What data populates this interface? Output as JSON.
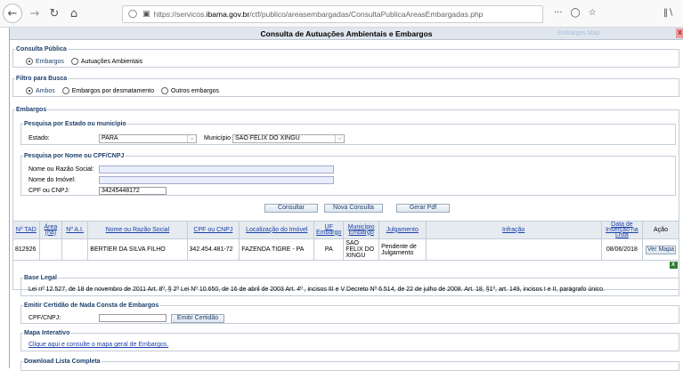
{
  "browser": {
    "url_prefix": "https://servicos.",
    "url_domain": "ibama.gov.br",
    "url_suffix": "/ctf/publico/areasembargadas/ConsultaPublicaAreasEmbargadas.php",
    "more_dots": "···"
  },
  "page": {
    "title": "Consulta de Autuações Ambientais e Embargos",
    "map_badge": "Embargos Map",
    "close_label": "X"
  },
  "consulta_publica": {
    "legend": "Consulta Pública",
    "options": [
      "Embargos",
      "Autuações Ambientais"
    ]
  },
  "filtro_busca": {
    "legend": "Filtro para Busca",
    "options": [
      "Ambos",
      "Embargos por desmatamento",
      "Outros embargos"
    ]
  },
  "embargos": {
    "legend": "Embargos"
  },
  "pesquisa_estado": {
    "legend": "Pesquisa por Estado ou município",
    "estado_label": "Estado:",
    "estado_value": "PARA",
    "municipio_label": "Município",
    "municipio_value": "SAO FELIX DO XINGU"
  },
  "pesquisa_nome": {
    "legend": "Pesquisa por Nome ou CPF/CNPJ",
    "nome_label": "Nome ou Razão Social:",
    "nome_value": "",
    "imovel_label": "Nome do Imóvel:",
    "imovel_value": "",
    "cpf_label": "CPF ou CNPJ:",
    "cpf_value": "34245448172"
  },
  "actions": {
    "consultar": "Consultar",
    "nova": "Nova Consulta",
    "pdf": "Gerar Pdf"
  },
  "table": {
    "headers": [
      "Nº TAD",
      "Área (ha)",
      "Nº A.I.",
      "Nome ou Razão Social",
      "CPF ou CNPJ",
      "Localização do Imóvel",
      "UF Embargo",
      "Município Embargo",
      "Julgamento",
      "Infração",
      "Data de Inserção na Lista",
      "Ação"
    ],
    "rows": [
      {
        "tad": "812926",
        "area": "",
        "ai": "",
        "nome": "BERTIER DA SILVA FILHO",
        "cpf": "342.454.481-72",
        "local": "FAZENDA TIGRE - PA",
        "uf": "PA",
        "municipio": "SAO FELIX DO XINGU",
        "julgamento": "Pendente de Julgamento",
        "infracao": "",
        "data": "08/06/2018",
        "acao": "Ver Mapa"
      }
    ],
    "export_icon": "excel-icon"
  },
  "base_legal": {
    "legend": "Base Legal",
    "text": "Lei nº 12.527, de 18 de novembro de 2011 Art. 8º, § 2º Lei Nº 10.650, de 16 de abril de 2003 Art. 4º , incisos III e V Decreto Nº 6.514, de 22 de julho de 2008. Art. 18, §1º, art. 149, incisos I e II, parágrafo único."
  },
  "certidao": {
    "legend": "Emitir Certidão de Nada Consta de Embargos",
    "label": "CPF/CNPJ:",
    "value": "",
    "button": "Emitir Certidão"
  },
  "mapa": {
    "legend": "Mapa Interativo",
    "link": "Clique aqui e consulte o mapa geral de Embargos."
  },
  "download": {
    "legend": "Download Lista Completa"
  }
}
